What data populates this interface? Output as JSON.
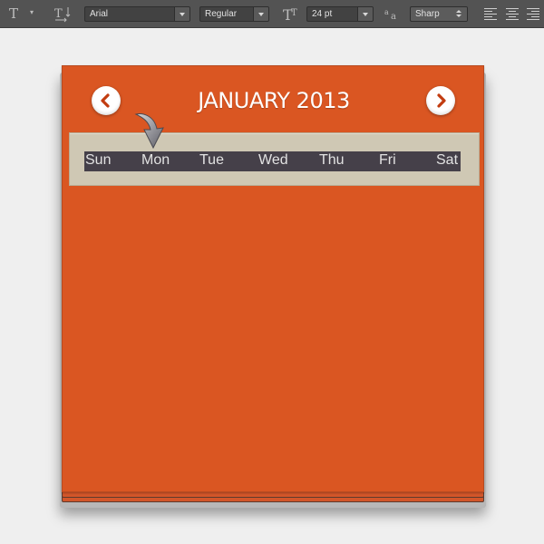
{
  "options_bar": {
    "tool_icon": "horizontal-type-tool-icon",
    "font_family": "Arial",
    "font_style": "Regular",
    "font_size": "24 pt",
    "anti_alias": "Sharp",
    "alignment": [
      "align-left-icon",
      "align-center-icon",
      "align-right-icon"
    ]
  },
  "calendar": {
    "month_title": "JANUARY 2013",
    "prev_icon": "chevron-left-icon",
    "next_icon": "chevron-right-icon",
    "weekdays": [
      "Sun",
      "Mon",
      "Tue",
      "Wed",
      "Thu",
      "Fri",
      "Sat"
    ]
  },
  "colors": {
    "card": "#da5622",
    "band": "#cfc8b4",
    "weekday_bar": "#454049",
    "toolbar": "#535353"
  }
}
